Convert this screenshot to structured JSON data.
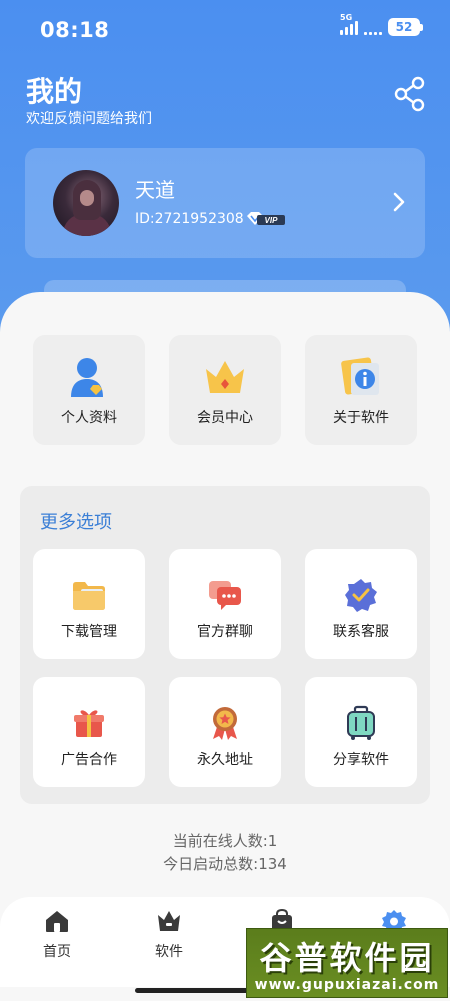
{
  "status_bar": {
    "time": "08:18",
    "network": "5G",
    "battery": "52"
  },
  "header": {
    "title": "我的",
    "subtitle": "欢迎反馈问题给我们"
  },
  "profile": {
    "name": "天道",
    "id": "ID:2721952308",
    "badge": "VIP"
  },
  "quick_actions": [
    {
      "label": "个人资料",
      "icon": "user-profile-icon"
    },
    {
      "label": "会员中心",
      "icon": "crown-icon"
    },
    {
      "label": "关于软件",
      "icon": "info-icon"
    }
  ],
  "more": {
    "title": "更多选项",
    "options": [
      {
        "label": "下载管理",
        "icon": "folder-icon"
      },
      {
        "label": "官方群聊",
        "icon": "chat-icon"
      },
      {
        "label": "联系客服",
        "icon": "verified-badge-icon"
      },
      {
        "label": "广告合作",
        "icon": "gift-icon"
      },
      {
        "label": "永久地址",
        "icon": "medal-icon"
      },
      {
        "label": "分享软件",
        "icon": "suitcase-icon"
      }
    ]
  },
  "stats": {
    "online": "当前在线人数:1",
    "launches": "今日启动总数:134"
  },
  "bottom_nav": [
    {
      "label": "首页",
      "icon": "home-icon"
    },
    {
      "label": "软件",
      "icon": "crown-tab-icon"
    },
    {
      "label": "",
      "icon": "bag-icon"
    },
    {
      "label": "",
      "icon": "gear-icon"
    }
  ],
  "watermark": {
    "title": "谷普软件园",
    "url": "www.gupuxiazai.com"
  },
  "colors": {
    "primary": "#4b8ff0",
    "accent_text": "#3b7fd6",
    "sheet": "#f7f7f7"
  }
}
